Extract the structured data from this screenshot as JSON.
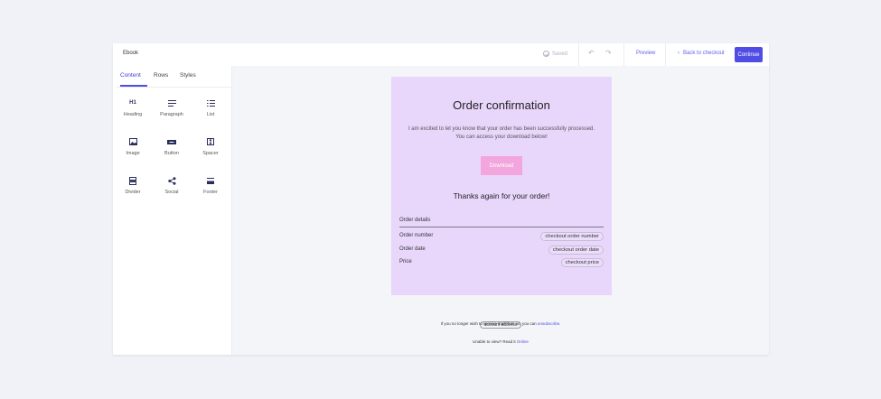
{
  "header": {
    "doc_title": "Ebook",
    "saved_label": "Saved",
    "preview_label": "Preview",
    "back_label": "Back to checkout",
    "continue_label": "Continue"
  },
  "sidebar": {
    "tabs": [
      {
        "label": "Content"
      },
      {
        "label": "Rows"
      },
      {
        "label": "Styles"
      }
    ],
    "blocks": [
      {
        "label": "Heading",
        "icon": "heading-icon",
        "glyph": "H1"
      },
      {
        "label": "Paragraph",
        "icon": "paragraph-icon"
      },
      {
        "label": "List",
        "icon": "list-icon"
      },
      {
        "label": "Image",
        "icon": "image-icon"
      },
      {
        "label": "Button",
        "icon": "button-icon"
      },
      {
        "label": "Spacer",
        "icon": "spacer-icon"
      },
      {
        "label": "Divider",
        "icon": "divider-icon"
      },
      {
        "label": "Social",
        "icon": "share-icon"
      },
      {
        "label": "Footer",
        "icon": "footer-icon"
      }
    ]
  },
  "email": {
    "title": "Order confirmation",
    "body_line1": "I am excited to let you know that your order has been successfully processed.",
    "body_line2": "You can access your download below!",
    "download_label": "Download",
    "thanks": "Thanks again for your order!",
    "details_heading": "Order details",
    "rows": [
      {
        "label": "Order number",
        "value": "checkout order number"
      },
      {
        "label": "Order date",
        "value": "checkout order date"
      },
      {
        "label": "Price",
        "value": "checkout price"
      }
    ],
    "background_color": "#e8d6fb",
    "button_color": "#f3a6dd"
  },
  "footer": {
    "address_tag": "account address",
    "unsub_text": "If you no longer wish to receive mail from us, you can",
    "unsub_link": "unsubscribe",
    "unable_text": "Unable to view? Read it",
    "online_link": "Online"
  },
  "colors": {
    "accent": "#4f4de4",
    "link": "#5b5ff0"
  }
}
